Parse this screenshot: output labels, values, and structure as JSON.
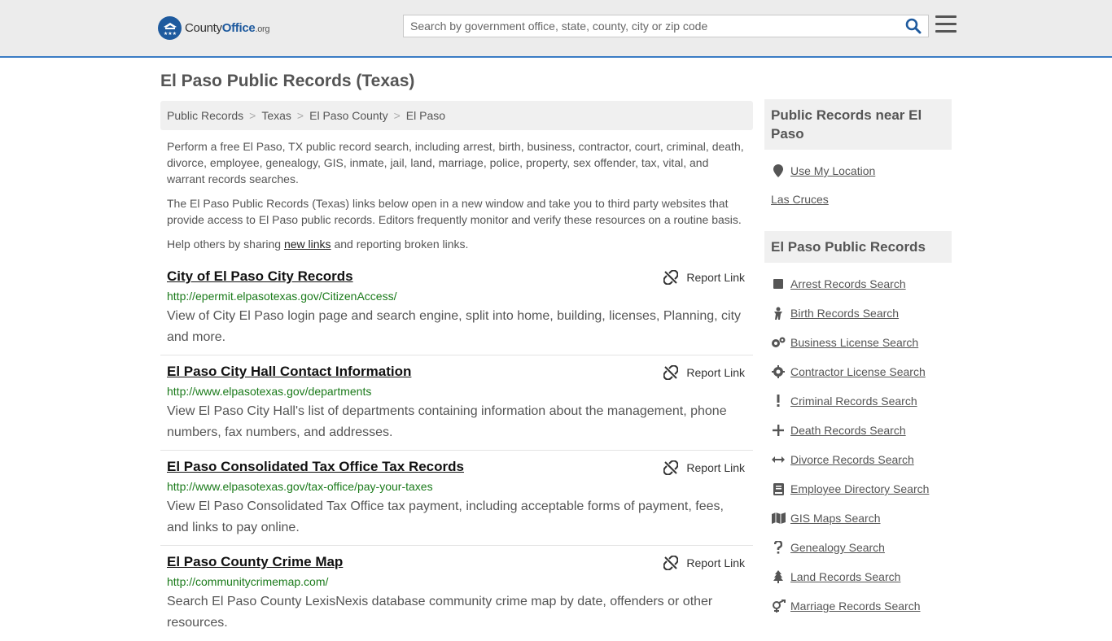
{
  "header": {
    "logo_main": "County",
    "logo_brand": "Office",
    "logo_tld": ".org",
    "search_placeholder": "Search by government office, state, county, city or zip code"
  },
  "page_title": "El Paso Public Records (Texas)",
  "breadcrumb": [
    "Public Records",
    "Texas",
    "El Paso County",
    "El Paso"
  ],
  "intro": {
    "p1": "Perform a free El Paso, TX public record search, including arrest, birth, business, contractor, court, criminal, death, divorce, employee, genealogy, GIS, inmate, jail, land, marriage, police, property, sex offender, tax, vital, and warrant records searches.",
    "p2": "The El Paso Public Records (Texas) links below open in a new window and take you to third party websites that provide access to El Paso public records. Editors frequently monitor and verify these resources on a routine basis.",
    "p3_before": "Help others by sharing ",
    "p3_link": "new links",
    "p3_after": " and reporting broken links."
  },
  "report_label": "Report Link",
  "listings": [
    {
      "title": "City of El Paso City Records",
      "url": "http://epermit.elpasotexas.gov/CitizenAccess/",
      "desc": "View of City El Paso login page and search engine, split into home, building, licenses, Planning, city and more."
    },
    {
      "title": "El Paso City Hall Contact Information",
      "url": "http://www.elpasotexas.gov/departments",
      "desc": "View El Paso City Hall's list of departments containing information about the management, phone numbers, fax numbers, and addresses."
    },
    {
      "title": "El Paso Consolidated Tax Office Tax Records",
      "url": "http://www.elpasotexas.gov/tax-office/pay-your-taxes",
      "desc": "View El Paso Consolidated Tax Office tax payment, including acceptable forms of payment, fees, and links to pay online."
    },
    {
      "title": "El Paso County Crime Map",
      "url": "http://communitycrimemap.com/",
      "desc": "Search El Paso County LexisNexis database community crime map by date, offenders or other resources."
    }
  ],
  "sidebar": {
    "near_title": "Public Records near El Paso",
    "use_location": "Use My Location",
    "nearby": "Las Cruces",
    "records_title": "El Paso Public Records",
    "links": [
      {
        "label": "Arrest Records Search",
        "icon": "square-icon"
      },
      {
        "label": "Birth Records Search",
        "icon": "baby-icon"
      },
      {
        "label": "Business License Search",
        "icon": "gears-icon"
      },
      {
        "label": "Contractor License Search",
        "icon": "gear-icon"
      },
      {
        "label": "Criminal Records Search",
        "icon": "exclamation-icon"
      },
      {
        "label": "Death Records Search",
        "icon": "cross-icon"
      },
      {
        "label": "Divorce Records Search",
        "icon": "arrows-horizontal-icon"
      },
      {
        "label": "Employee Directory Search",
        "icon": "book-icon"
      },
      {
        "label": "GIS Maps Search",
        "icon": "map-icon"
      },
      {
        "label": "Genealogy Search",
        "icon": "question-icon"
      },
      {
        "label": "Land Records Search",
        "icon": "tree-icon"
      },
      {
        "label": "Marriage Records Search",
        "icon": "gender-icon"
      }
    ]
  }
}
